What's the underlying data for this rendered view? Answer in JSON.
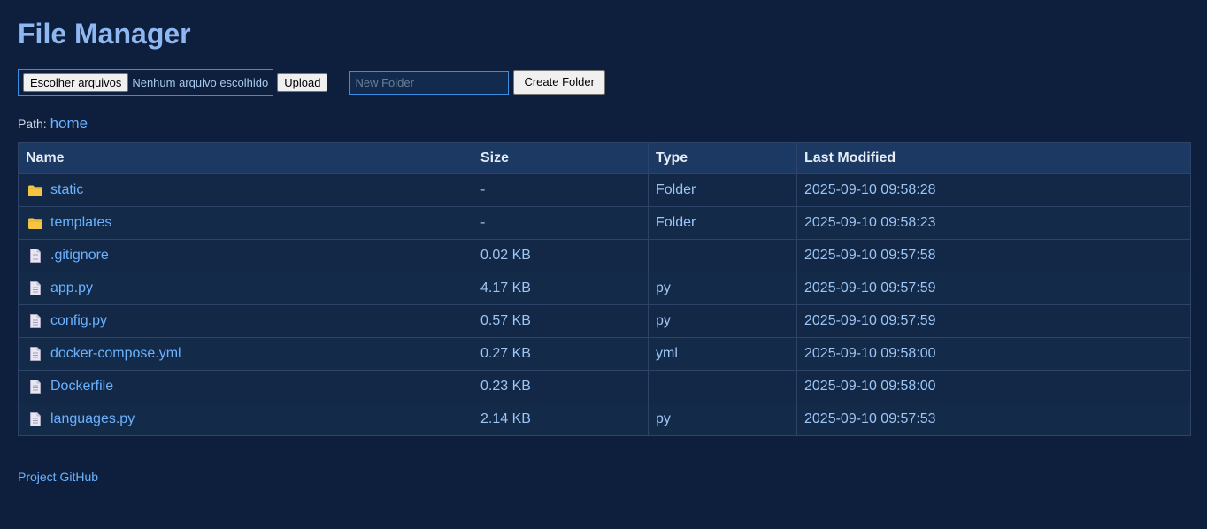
{
  "header": {
    "title": "File Manager"
  },
  "toolbar": {
    "choose_files_label": "Escolher arquivos",
    "no_file_text": "Nenhum arquivo escolhido",
    "upload_label": "Upload",
    "folder_placeholder": "New Folder",
    "folder_value": "",
    "create_folder_label": "Create Folder"
  },
  "path": {
    "label": "Path:",
    "segments": [
      "home"
    ]
  },
  "table": {
    "columns": [
      "Name",
      "Size",
      "Type",
      "Last Modified"
    ],
    "rows": [
      {
        "icon": "folder-icon",
        "name": "static",
        "size": "-",
        "type": "Folder",
        "modified": "2025-09-10 09:58:28"
      },
      {
        "icon": "folder-icon",
        "name": "templates",
        "size": "-",
        "type": "Folder",
        "modified": "2025-09-10 09:58:23"
      },
      {
        "icon": "file-icon",
        "name": ".gitignore",
        "size": "0.02 KB",
        "type": "",
        "modified": "2025-09-10 09:57:58"
      },
      {
        "icon": "file-icon",
        "name": "app.py",
        "size": "4.17 KB",
        "type": "py",
        "modified": "2025-09-10 09:57:59"
      },
      {
        "icon": "file-icon",
        "name": "config.py",
        "size": "0.57 KB",
        "type": "py",
        "modified": "2025-09-10 09:57:59"
      },
      {
        "icon": "file-icon",
        "name": "docker-compose.yml",
        "size": "0.27 KB",
        "type": "yml",
        "modified": "2025-09-10 09:58:00"
      },
      {
        "icon": "file-icon",
        "name": "Dockerfile",
        "size": "0.23 KB",
        "type": "",
        "modified": "2025-09-10 09:58:00"
      },
      {
        "icon": "file-icon",
        "name": "languages.py",
        "size": "2.14 KB",
        "type": "py",
        "modified": "2025-09-10 09:57:53"
      }
    ]
  },
  "footer": {
    "github_label": "Project GitHub"
  },
  "colors": {
    "background": "#0d1f3c",
    "accent": "#6cb2ff",
    "title": "#8fb8f2",
    "folder_icon": "#f5c542",
    "file_icon": "#e8e6f0"
  }
}
